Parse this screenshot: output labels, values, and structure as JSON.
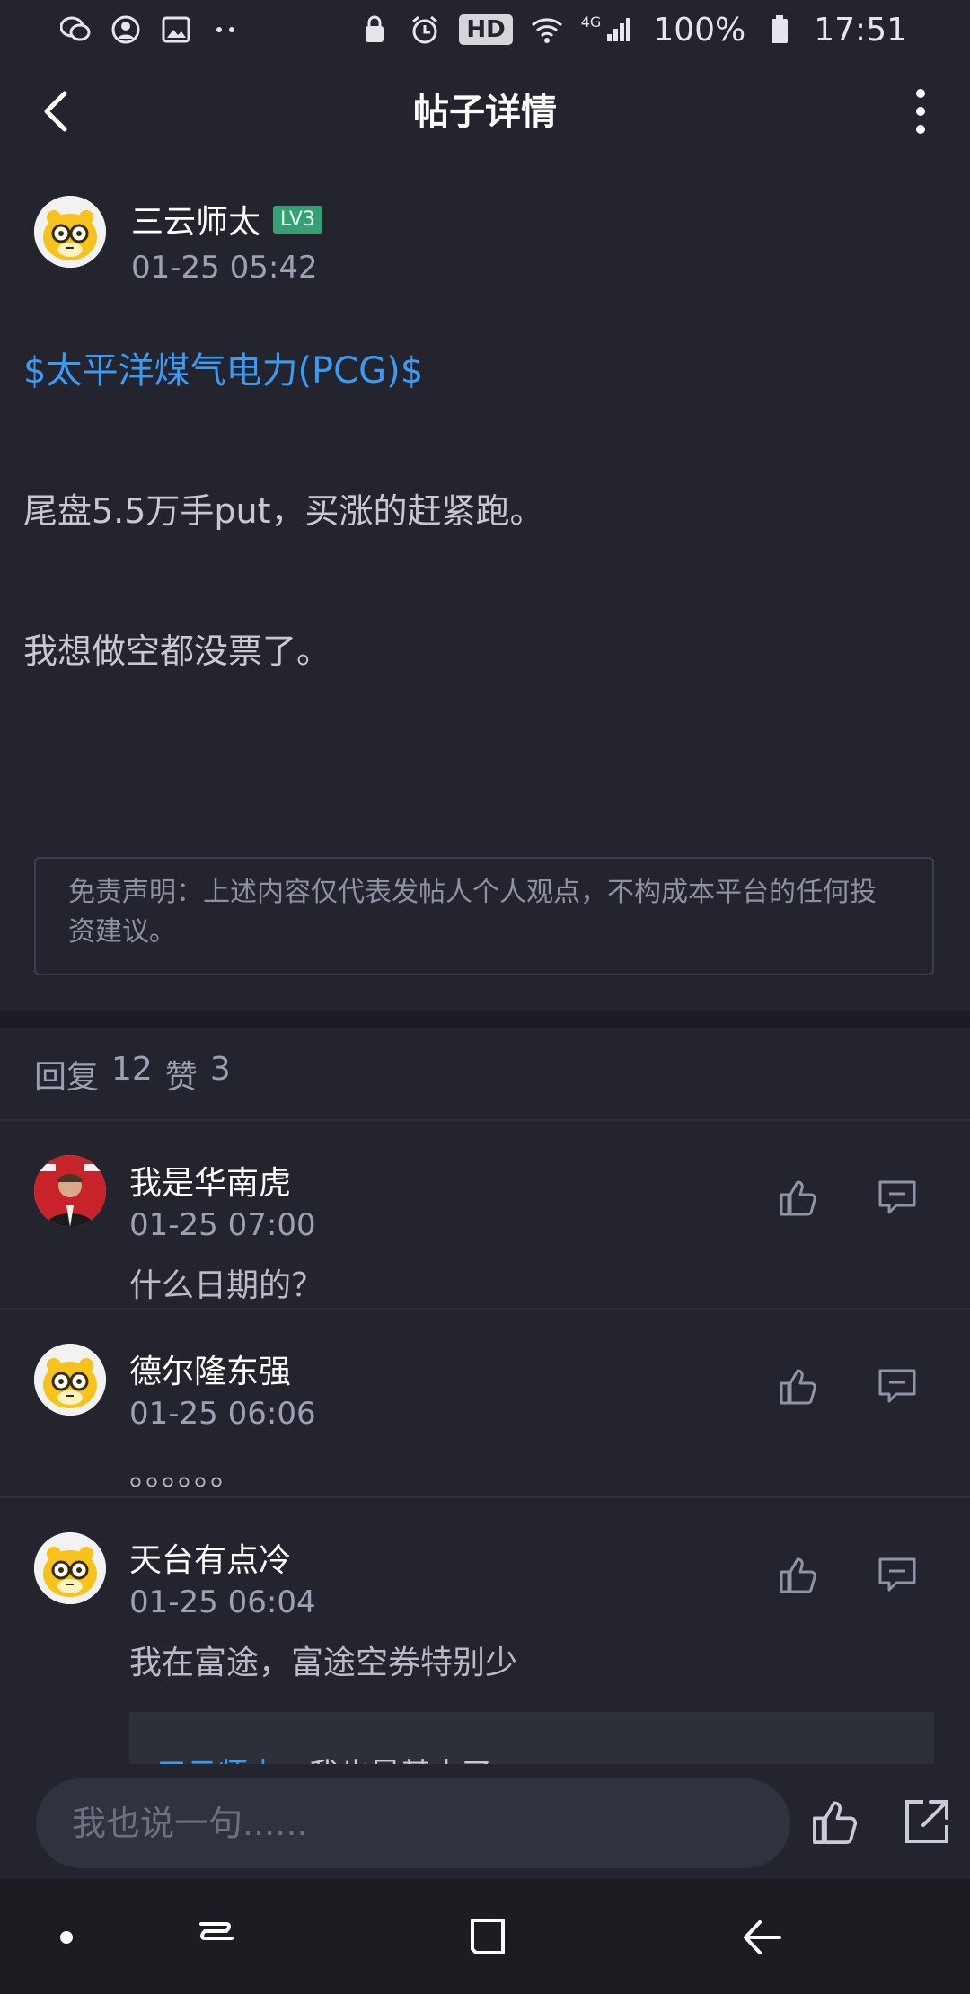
{
  "status_bar": {
    "battery": "100%",
    "time": "17:51",
    "hd_label": "HD",
    "network_label": "4G",
    "left_icons": [
      "wechat-icon",
      "account-icon",
      "image-icon",
      "more-dots-icon"
    ],
    "right_icons": [
      "lock-icon",
      "alarm-icon",
      "wifi-icon",
      "signal-icon",
      "battery-icon"
    ]
  },
  "header": {
    "title": "帖子详情"
  },
  "post": {
    "author": {
      "name": "三云师太",
      "level": "LV3",
      "time": "01-25 05:42"
    },
    "stock_tag": "$太平洋煤气电力(PCG)$",
    "lines": [
      "尾盘5.5万手put，买涨的赶紧跑。",
      "我想做空都没票了。"
    ],
    "disclaimer": "免责声明：上述内容仅代表发帖人个人观点，不构成本平台的任何投资建议。"
  },
  "stats": {
    "reply_label": "回复",
    "reply_count": "12",
    "like_label": "赞",
    "like_count": "3"
  },
  "comments": [
    {
      "name": "我是华南虎",
      "time": "01-25 07:00",
      "text": "什么日期的？"
    },
    {
      "name": "德尔隆东强",
      "time": "01-25 06:06",
      "text": "。。。。。。"
    },
    {
      "name": "天台有点冷",
      "time": "01-25 06:04",
      "text": "我在富途，富途空券特别少"
    }
  ],
  "quoted_reply": {
    "user": "三云师太",
    "text": "：我也是基本了"
  },
  "composer": {
    "placeholder": "我也说一句......"
  },
  "colors": {
    "background": "#23242d",
    "accent_blue": "#3b9bf2",
    "level_green": "#35a074"
  }
}
